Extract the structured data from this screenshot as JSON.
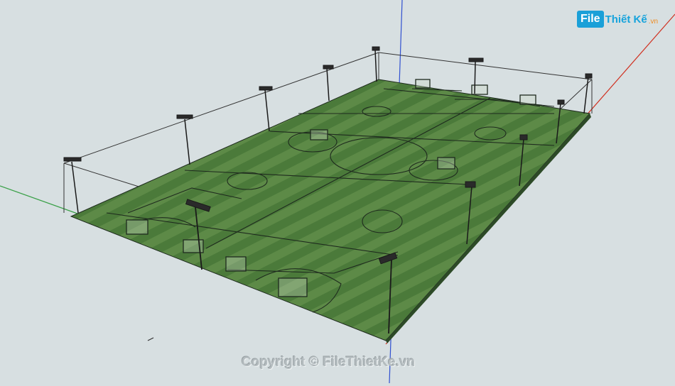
{
  "watermark": {
    "logo_file": "File",
    "logo_rest": "Thiết Kế",
    "logo_tld": ".vn",
    "copyright": "Copyright © FileThietKe.vn"
  },
  "model": {
    "subject": "soccer-field-3d-model",
    "colors": {
      "background": "#d7dfe1",
      "turf_dark": "#3f6e34",
      "turf_light": "#5f8b48",
      "lines": "#1e2a1e",
      "axis_red": "#d03020",
      "axis_green": "#3aa048",
      "axis_blue": "#3050d0"
    },
    "light_pole_count": 13,
    "goal_count": 10
  }
}
